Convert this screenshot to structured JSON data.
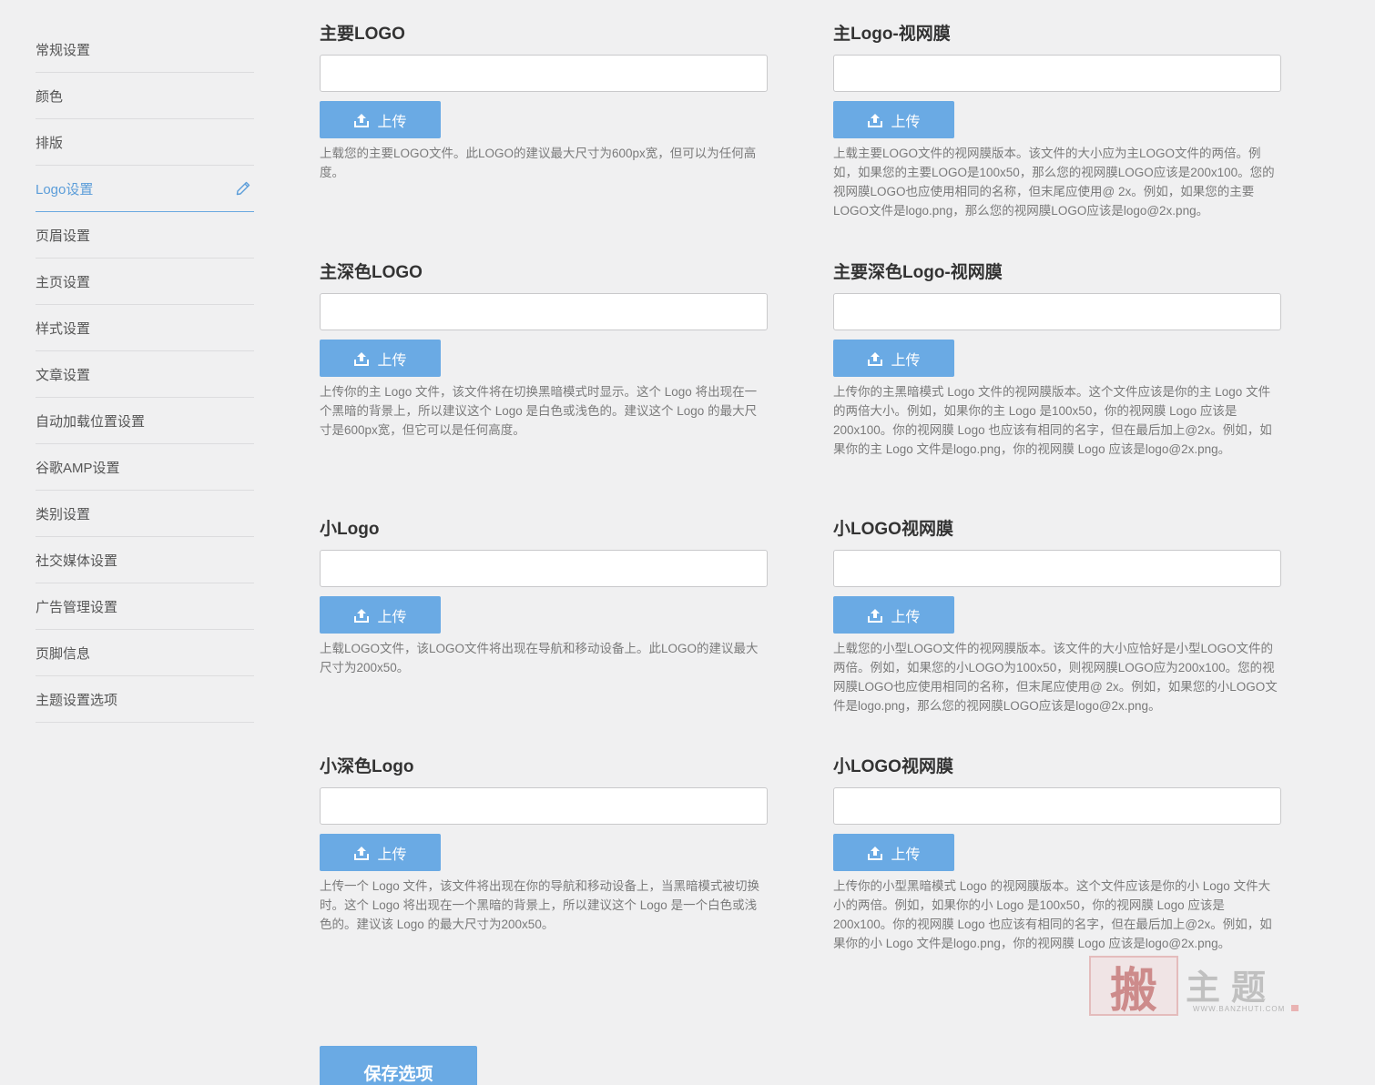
{
  "sidebar": {
    "items": [
      {
        "label": "常规设置"
      },
      {
        "label": "颜色"
      },
      {
        "label": "排版"
      },
      {
        "label": "Logo设置"
      },
      {
        "label": "页眉设置"
      },
      {
        "label": "主页设置"
      },
      {
        "label": "样式设置"
      },
      {
        "label": "文章设置"
      },
      {
        "label": "自动加载位置设置"
      },
      {
        "label": "谷歌AMP设置"
      },
      {
        "label": "类别设置"
      },
      {
        "label": "社交媒体设置"
      },
      {
        "label": "广告管理设置"
      },
      {
        "label": "页脚信息"
      },
      {
        "label": "主题设置选项"
      }
    ],
    "active_index": 3,
    "active_icon": "pencil-edit-icon"
  },
  "fields": {
    "main_logo": {
      "label": "主要LOGO",
      "value": "",
      "upload_label": "上传",
      "desc": "上载您的主要LOGO文件。此LOGO的建议最大尺寸为600px宽，但可以为任何高度。"
    },
    "main_logo_retina": {
      "label": "主Logo-视网膜",
      "value": "",
      "upload_label": "上传",
      "desc": "上载主要LOGO文件的视网膜版本。该文件的大小应为主LOGO文件的两倍。例如，如果您的主要LOGO是100x50，那么您的视网膜LOGO应该是200x100。您的视网膜LOGO也应使用相同的名称，但末尾应使用@ 2x。例如，如果您的主要LOGO文件是logo.png，那么您的视网膜LOGO应该是logo@2x.png。"
    },
    "main_dark_logo": {
      "label": "主深色LOGO",
      "value": "",
      "upload_label": "上传",
      "desc": "上传你的主 Logo 文件，该文件将在切换黑暗模式时显示。这个 Logo 将出现在一个黑暗的背景上，所以建议这个 Logo 是白色或浅色的。建议这个 Logo 的最大尺寸是600px宽，但它可以是任何高度。"
    },
    "main_dark_logo_retina": {
      "label": "主要深色Logo-视网膜",
      "value": "",
      "upload_label": "上传",
      "desc": "上传你的主黑暗模式 Logo 文件的视网膜版本。这个文件应该是你的主 Logo 文件的两倍大小。例如，如果你的主 Logo 是100x50，你的视网膜 Logo 应该是200x100。你的视网膜 Logo 也应该有相同的名字，但在最后加上@2x。例如，如果你的主 Logo 文件是logo.png，你的视网膜 Logo 应该是logo@2x.png。"
    },
    "small_logo": {
      "label": "小Logo",
      "value": "",
      "upload_label": "上传",
      "desc": "上载LOGO文件，该LOGO文件将出现在导航和移动设备上。此LOGO的建议最大尺寸为200x50。"
    },
    "small_logo_retina": {
      "label": "小LOGO视网膜",
      "value": "",
      "upload_label": "上传",
      "desc": "上载您的小型LOGO文件的视网膜版本。该文件的大小应恰好是小型LOGO文件的两倍。例如，如果您的小LOGO为100x50，则视网膜LOGO应为200x100。您的视网膜LOGO也应使用相同的名称，但末尾应使用@ 2x。例如，如果您的小LOGO文件是logo.png，那么您的视网膜LOGO应该是logo@2x.png。"
    },
    "small_dark_logo": {
      "label": "小深色Logo",
      "value": "",
      "upload_label": "上传",
      "desc": "上传一个 Logo 文件，该文件将出现在你的导航和移动设备上，当黑暗模式被切换时。这个 Logo 将出现在一个黑暗的背景上，所以建议这个 Logo 是一个白色或浅色的。建议该 Logo 的最大尺寸为200x50。"
    },
    "small_dark_logo_retina": {
      "label": "小LOGO视网膜",
      "value": "",
      "upload_label": "上传",
      "desc": "上传你的小型黑暗模式 Logo 的视网膜版本。这个文件应该是你的小 Logo 文件大小的两倍。例如，如果你的小 Logo 是100x50，你的视网膜 Logo 应该是200x100。你的视网膜 Logo 也应该有相同的名字，但在最后加上@2x。例如，如果你的小 Logo 文件是logo.png，你的视网膜 Logo 应该是logo@2x.png。"
    }
  },
  "save_label": "保存选项",
  "watermark": {
    "seal_char": "搬",
    "text": "主题",
    "url": "WWW.BANZHUTI.COM"
  },
  "colors": {
    "accent": "#6aaae4",
    "active_nav": "#5b9dd9",
    "background": "#f0f0f1"
  },
  "icons": {
    "upload": "upload-icon"
  }
}
